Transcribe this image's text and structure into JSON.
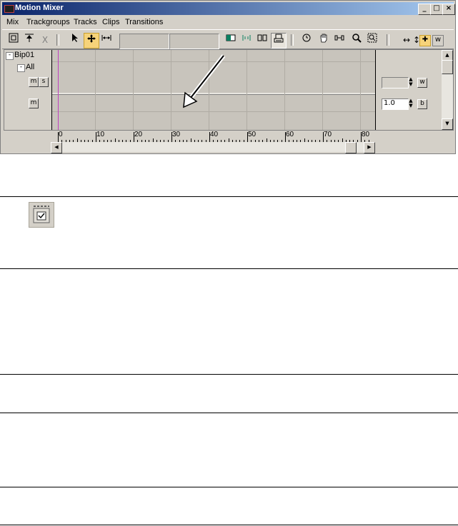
{
  "window": {
    "title": "Motion Mixer",
    "controls": {
      "minimize": "_",
      "maximize": "□",
      "close": "×"
    }
  },
  "menu": [
    "Mix",
    "Trackgroups",
    "Tracks",
    "Clips",
    "Transitions"
  ],
  "toolbar": {
    "icons": [
      "mixer-settings-icon",
      "trackgroup-icon",
      "delete-x-icon",
      "select-arrow-icon",
      "move-icon",
      "slide-icon",
      "clip-bounds-icon",
      "frame-icon",
      "loop-icon",
      "snap-icon",
      "time-icon",
      "pan-hand-icon",
      "zoom-extents-icon",
      "zoom-icon",
      "zoom-region-icon",
      "horizontal-icon",
      "vertical-icon",
      "filter-icon",
      "weight-icon"
    ],
    "delete_glyph": "X",
    "w_label": "w"
  },
  "tracks": {
    "root": {
      "expander": "-",
      "label": "Bip01"
    },
    "group": {
      "expander": "-",
      "label": "All"
    },
    "row1": {
      "m": "m",
      "s": "s",
      "value": "",
      "btn": "w"
    },
    "row2": {
      "m": "m",
      "value": "1.0",
      "btn": "b"
    }
  },
  "ruler": {
    "labels": [
      "0",
      "10",
      "20",
      "30",
      "40",
      "50",
      "60",
      "70",
      "80"
    ]
  },
  "colors": {
    "titlebar_start": "#0a246a",
    "titlebar_end": "#a6caf0",
    "panel": "#d4d0c8",
    "highlight": "#f6d37a",
    "time_cursor": "#c040c0"
  }
}
